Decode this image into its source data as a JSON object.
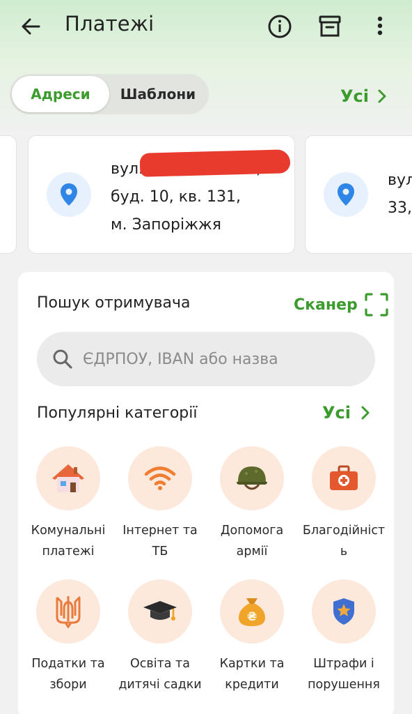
{
  "header": {
    "title": "Платежі",
    "icons": [
      "back-arrow-icon",
      "info-icon",
      "archive-icon",
      "more-vertical-icon"
    ]
  },
  "tabs": {
    "addresses": "Адреси",
    "templates": "Шаблони",
    "all_label": "Усі"
  },
  "addresses": {
    "main": {
      "line1": "вул.",
      "line1_tail": ",",
      "line2": "буд. 10, кв. 131,",
      "line3": "м. Запоріжжя"
    },
    "right": {
      "line1": "вул",
      "line2": "33,"
    }
  },
  "search": {
    "title": "Пошук отримувача",
    "scanner_label": "Сканер",
    "placeholder": "ЄДРПОУ, IBAN або назва"
  },
  "popular": {
    "title": "Популярні категорії",
    "all_label": "Усі",
    "categories": [
      {
        "label": "Комунальні\nплатежі",
        "icon": "house-icon"
      },
      {
        "label": "Інтернет та\nТБ",
        "icon": "wifi-icon"
      },
      {
        "label": "Допомога\nармії",
        "icon": "helmet-icon"
      },
      {
        "label": "Благодійніст\nь",
        "icon": "first-aid-kit-icon"
      },
      {
        "label": "Податки та\nзбори",
        "icon": "trident-icon"
      },
      {
        "label": "Освіта та\nдитячі садки",
        "icon": "graduation-cap-icon"
      },
      {
        "label": "Картки та\nкредити",
        "icon": "money-bag-icon"
      },
      {
        "label": "Штрафи і\nпорушення",
        "icon": "police-badge-icon"
      }
    ]
  },
  "colors": {
    "accent": "#3b9b2d",
    "pin": "#2f86e6",
    "category_bg": "#fde8dc"
  }
}
